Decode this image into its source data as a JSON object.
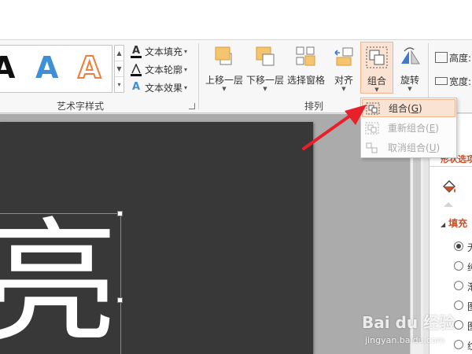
{
  "ribbon": {
    "wordart_styles": {
      "label": "艺术字样式",
      "samples": [
        "A",
        "A",
        "A"
      ],
      "text_fill": "文本填充",
      "text_outline": "文本轮廓",
      "text_effects": "文本效果",
      "glyph_a": "A"
    },
    "arrange": {
      "label": "排列",
      "bring_forward": "上移一层",
      "send_backward": "下移一层",
      "selection_pane": "选择窗格",
      "align": "对齐",
      "group": "组合",
      "rotate": "旋转"
    },
    "size": {
      "height": "高度:",
      "width": "宽度:"
    }
  },
  "group_menu": {
    "items": [
      {
        "label": "组合(",
        "key": "G",
        "suffix": ")",
        "enabled": true
      },
      {
        "label": "重新组合(",
        "key": "E",
        "suffix": ")",
        "enabled": false
      },
      {
        "label": "取消组合(",
        "key": "U",
        "suffix": ")",
        "enabled": false
      }
    ]
  },
  "slide": {
    "text": "亮"
  },
  "format_pane": {
    "title": "置",
    "subtitle": "形状选项",
    "section": "填充",
    "radio_options": [
      "无",
      "纯",
      "渐",
      "图",
      "图",
      "纹"
    ]
  },
  "watermark": {
    "brand": "Bai du 经验",
    "url": "jingyan.baidu.com"
  },
  "colors": {
    "accent": "#c9502a",
    "highlight": "#fbe3d4",
    "slide_bg": "#383838",
    "arrow": "#e8202a"
  }
}
